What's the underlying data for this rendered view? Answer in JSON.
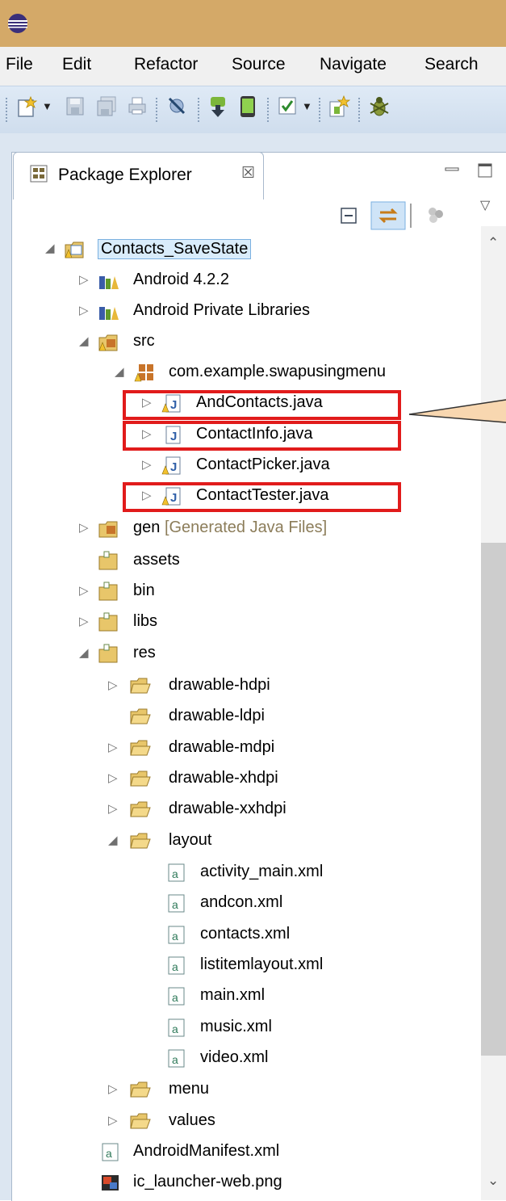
{
  "menubar": {
    "items": [
      "File",
      "Edit",
      "Refactor",
      "Source",
      "Navigate",
      "Search"
    ]
  },
  "toolbar": {
    "buttons": [
      "new-wizard-icon",
      "dropdown-arrow-icon",
      "save-icon",
      "save-all-icon",
      "print-icon",
      "skip-breakpoints-icon",
      "android-sdk-manager-icon",
      "android-avd-manager-icon",
      "run-lint-icon",
      "dropdown-arrow-icon",
      "new-android-project-icon",
      "debug-icon"
    ]
  },
  "view": {
    "tab_label": "Package Explorer",
    "close_glyph": "☒",
    "scroll_up": "⌃",
    "scroll_down": "⌄"
  },
  "tree": {
    "project": "Contacts_SaveState",
    "android_version": "Android 4.2.2",
    "private_libs": "Android Private Libraries",
    "src": "src",
    "package": "com.example.swapusingmenu",
    "files": [
      "AndContacts.java",
      "ContactInfo.java",
      "ContactPicker.java",
      "ContactTester.java"
    ],
    "gen": "gen",
    "gen_note": "[Generated Java Files]",
    "assets": "assets",
    "bin": "bin",
    "libs": "libs",
    "res": "res",
    "res_folders": [
      "drawable-hdpi",
      "drawable-ldpi",
      "drawable-mdpi",
      "drawable-xhdpi",
      "drawable-xxhdpi",
      "layout"
    ],
    "layout_files": [
      "activity_main.xml",
      "andcon.xml",
      "contacts.xml",
      "listitemlayout.xml",
      "main.xml",
      "music.xml",
      "video.xml"
    ],
    "menu": "menu",
    "values": "values",
    "manifest": "AndroidManifest.xml",
    "launcher": "ic_launcher-web.png"
  },
  "colors": {
    "highlight": "#e11b1b",
    "titlebar": "#d4a968",
    "callout": "#f8d7b0"
  }
}
